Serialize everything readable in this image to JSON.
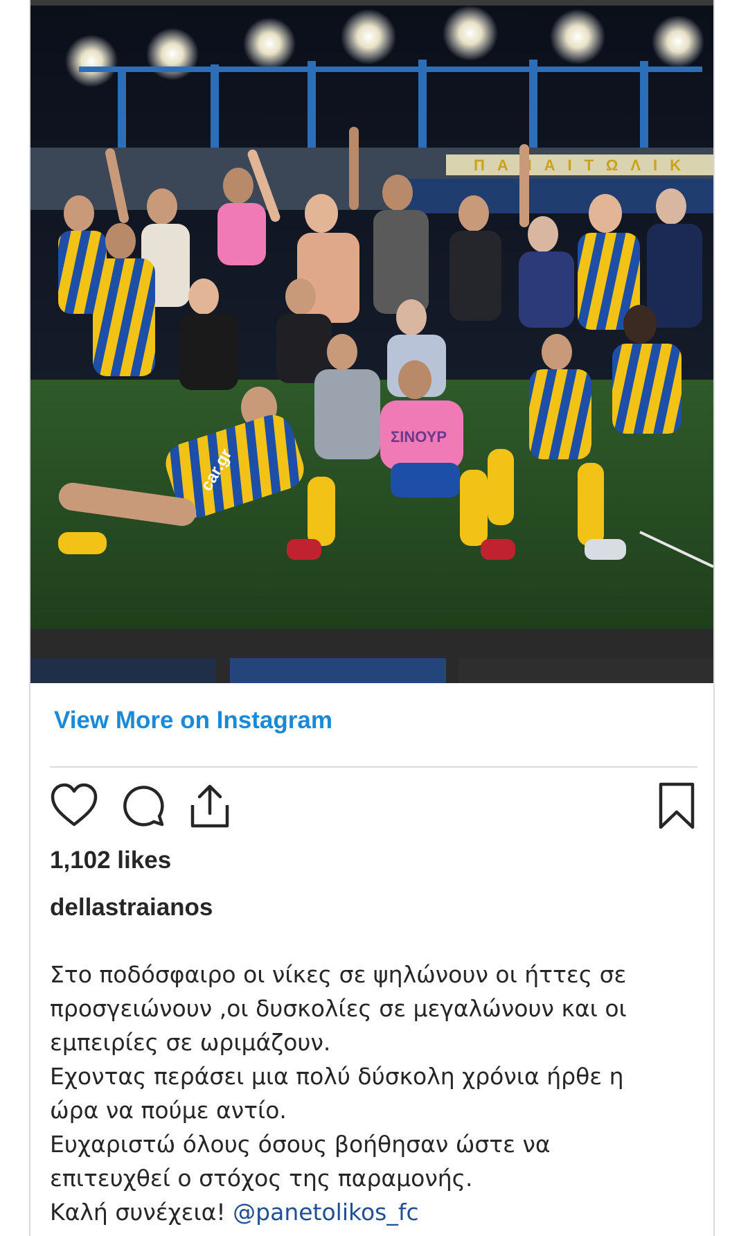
{
  "post": {
    "view_more_label": "View More on Instagram",
    "likes": "1,102 likes",
    "username": "dellastraianos",
    "caption_lines": [
      "Στο ποδόσφαιρο οι νίκες σε ψηλώνουν οι ήττες σε",
      "προσγειώνουν ,οι δυσκολίες σε μεγαλώνουν και οι",
      "εμπειρίες σε ωριμάζουν.",
      "Εχοντας περάσει μια πολύ δύσκολη χρόνια ήρθε η",
      "ώρα να πούμε αντίο.",
      "Ευχαριστώ όλους όσους βοήθησαν ώστε να",
      "επιτευχθεί ο στόχος της παραμονής."
    ],
    "caption_last_prefix": "Καλή συνέχεια! ",
    "mention": "@panetolikos_fc"
  },
  "photo": {
    "stadium_sign": "ΠΑΝΑΙΤΩΛΙΚ",
    "jersey_text": "car.gr",
    "bib_text": "ΣΙΝΟΥΡ"
  },
  "icons": {
    "like": "heart-icon",
    "comment": "comment-icon",
    "share": "share-icon",
    "save": "bookmark-icon"
  },
  "colors": {
    "link_blue": "#1a8ad8",
    "mention_blue": "#1f4f96",
    "text": "#262626",
    "divider": "#dbdbdb"
  }
}
